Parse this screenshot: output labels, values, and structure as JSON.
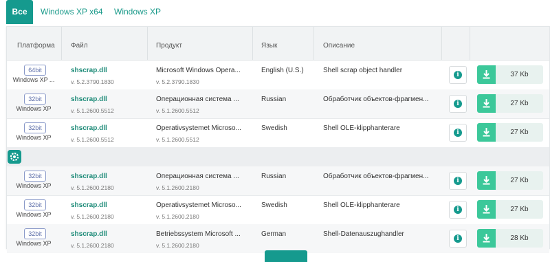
{
  "tabs": [
    {
      "label": "Все"
    },
    {
      "label": "Windows XP x64"
    },
    {
      "label": "Windows XP"
    }
  ],
  "table": {
    "headers": {
      "platform": "Платформа",
      "file": "Файл",
      "product": "Продукт",
      "language": "Язык",
      "description": "Описание"
    },
    "rows": [
      {
        "bit": "64bit",
        "platform": "Windows XP ...",
        "file": "shscrap.dll",
        "version": "v. 5.2.3790.1830",
        "product": "Microsoft Windows Opera...",
        "product_version": "v. 5.2.3790.1830",
        "language": "English (U.S.)",
        "description": "Shell scrap object handler",
        "size": "37 Kb"
      },
      {
        "bit": "32bit",
        "platform": "Windows XP",
        "file": "shscrap.dll",
        "version": "v. 5.1.2600.5512",
        "product": "Операционная система ...",
        "product_version": "v. 5.1.2600.5512",
        "language": "Russian",
        "description": "Обработчик объектов-фрагмен...",
        "size": "27 Kb"
      },
      {
        "bit": "32bit",
        "platform": "Windows XP",
        "file": "shscrap.dll",
        "version": "v. 5.1.2600.5512",
        "product": "Operativsystemet Microso...",
        "product_version": "v. 5.1.2600.5512",
        "language": "Swedish",
        "description": "Shell OLE-klipphanterare",
        "size": "27 Kb"
      },
      {
        "bit": "32bit",
        "platform": "Windows XP",
        "file": "shscrap.dll",
        "version": "v. 5.1.2600.2180",
        "product": "Операционная система ...",
        "product_version": "v. 5.1.2600.2180",
        "language": "Russian",
        "description": "Обработчик объектов-фрагмен...",
        "size": "27 Kb"
      },
      {
        "bit": "32bit",
        "platform": "Windows XP",
        "file": "shscrap.dll",
        "version": "v. 5.1.2600.2180",
        "product": "Operativsystemet Microso...",
        "product_version": "v. 5.1.2600.2180",
        "language": "Swedish",
        "description": "Shell OLE-klipphanterare",
        "size": "27 Kb"
      },
      {
        "bit": "32bit",
        "platform": "Windows XP",
        "file": "shscrap.dll",
        "version": "v. 5.1.2600.2180",
        "product": "Betriebssystem Microsoft ...",
        "product_version": "v. 5.1.2600.2180",
        "language": "German",
        "description": "Shell-Datenauszughandler",
        "size": "28 Kb"
      }
    ]
  },
  "icons": {
    "info": "info-icon",
    "download": "download-icon",
    "settings": "gear-icon"
  },
  "colors": {
    "accent": "#159a8e",
    "download": "#3cc89a",
    "link": "#1d8b78"
  }
}
